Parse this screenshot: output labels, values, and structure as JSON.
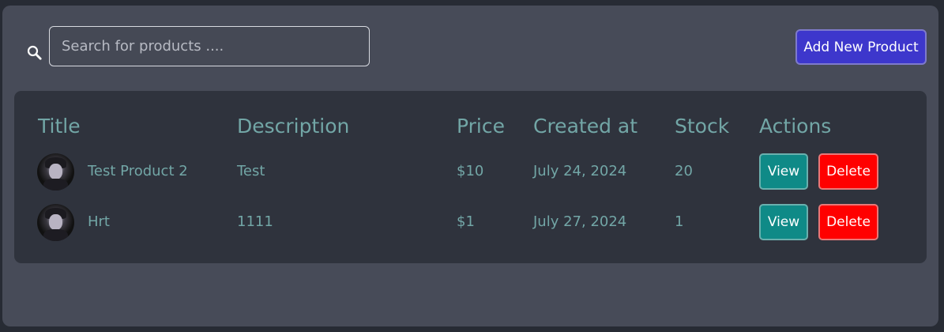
{
  "search": {
    "placeholder": "Search for products ....",
    "value": ""
  },
  "toolbar": {
    "add_label": "Add New Product"
  },
  "table": {
    "headers": [
      "Title",
      "Description",
      "Price",
      "Created at",
      "Stock",
      "Actions"
    ],
    "rows": [
      {
        "title": "Test Product 2",
        "description": "Test",
        "price": "$10",
        "created_at": "July 24, 2024",
        "stock": "20",
        "view_label": "View",
        "delete_label": "Delete"
      },
      {
        "title": "Hrt",
        "description": "1111",
        "price": "$1",
        "created_at": "July 27, 2024",
        "stock": "1",
        "view_label": "View",
        "delete_label": "Delete"
      }
    ]
  },
  "colors": {
    "page_bg": "#272b34",
    "panel_bg": "#474b58",
    "table_bg": "#2f333d",
    "text_accent": "#72a6a6",
    "primary_button": "#3d37cc",
    "view_button": "#0f8a87",
    "delete_button": "#ff0000"
  },
  "icons": {
    "search": "search-icon"
  }
}
